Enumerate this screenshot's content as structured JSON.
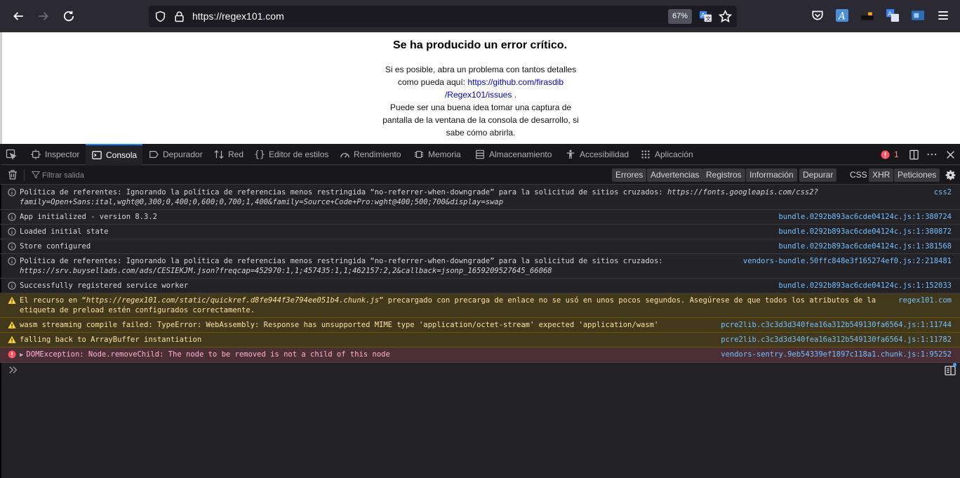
{
  "browser": {
    "url": "https://regex101.com",
    "zoom": "67%",
    "icons": [
      "back-arrow-icon",
      "forward-arrow-icon",
      "reload-icon",
      "shield-icon",
      "lock-icon",
      "translate-icon",
      "bookmark-star-icon",
      "pocket-icon",
      "extension-a-icon",
      "extension-dark-icon",
      "translate-ext-icon",
      "extension-blue-icon",
      "hamburger-menu-icon"
    ]
  },
  "page": {
    "title": "Se ha producido un error crítico.",
    "line1": "Si es posible, abra un problema con tantos detalles como pueda aquí:",
    "link": "https://github.com/firasdib/Regex101/issues",
    "link_line1": "https://github.com/firasdib",
    "link_line2": "/Regex101/issues",
    "after_link": " .",
    "line2": "Puede ser una buena idea tomar una captura de pantalla de la ventana de la consola de desarrollo, si sabe cómo abrirla."
  },
  "devtools": {
    "tabs": [
      {
        "label": "Inspector"
      },
      {
        "label": "Consola"
      },
      {
        "label": "Depurador"
      },
      {
        "label": "Red"
      },
      {
        "label": "Editor de estilos"
      },
      {
        "label": "Rendimiento"
      },
      {
        "label": "Memoria"
      },
      {
        "label": "Almacenamiento"
      },
      {
        "label": "Accesibilidad"
      },
      {
        "label": "Aplicación"
      }
    ],
    "active_tab": "Consola",
    "error_count": "1",
    "filter_placeholder": "Filtrar salida",
    "filter_buttons": [
      "Errores",
      "Advertencias",
      "Registros",
      "Información",
      "Depurar"
    ],
    "request_buttons": [
      "CSS",
      "XHR",
      "Peticiones"
    ]
  },
  "console": {
    "rows": [
      {
        "level": "info",
        "text": "Política de referentes: Ignorando la política de referencias menos restringida “no-referrer-when-downgrade” para la solicitud de sitios cruzados: ",
        "italic": "https://fonts.googleapis.com/css2?family=Open+Sans:ital,wght@0,300;0,400;0,600;0,700;1,400&family=Source+Code+Pro:wght@400;500;700&display=swap",
        "source": "css2"
      },
      {
        "level": "info",
        "text": "App initialized - version 8.3.2",
        "italic": "",
        "source": "bundle.0292b893ac6cde04124c.js:1:380724"
      },
      {
        "level": "info",
        "text": "Loaded initial state",
        "italic": "",
        "source": "bundle.0292b893ac6cde04124c.js:1:380872"
      },
      {
        "level": "info",
        "text": "Store configured",
        "italic": "",
        "source": "bundle.0292b893ac6cde04124c.js:1:381568"
      },
      {
        "level": "info",
        "text": "Política de referentes: Ignorando la política de referencias menos restringida “no-referrer-when-downgrade” para la solicitud de sitios cruzados: ",
        "italic": "https://srv.buysellads.com/ads/CESIEKJM.json?freqcap=452970:1,1;457435:1,1;462157:2,2&callback=jsonp_1659209527645_66068",
        "source": "vendors-bundle.50ffc848e3f165274ef0.js:2:218481"
      },
      {
        "level": "info",
        "text": "Successfully registered service worker",
        "italic": "",
        "source": "bundle.0292b893ac6cde04124c.js:1:152033"
      },
      {
        "level": "warn",
        "text": "El recurso en “",
        "italic": "https://regex101.com/static/quickref.d8fe944f3e794ee051b4.chunk.js",
        "text_after": "” precargado con precarga de enlace no se usó en unos pocos segundos. Asegúrese de que todos los atributos de la etiqueta de preload estén configurados correctamente.",
        "source": "regex101.com"
      },
      {
        "level": "warn",
        "text": "wasm streaming compile failed: TypeError: WebAssembly: Response has unsupported MIME type 'application/octet-stream' expected 'application/wasm'",
        "italic": "",
        "source": "pcre2lib.c3c3d3d340fea16a312b549130fa6564.js:1:11744"
      },
      {
        "level": "warn",
        "text": "falling back to ArrayBuffer instantiation",
        "italic": "",
        "source": "pcre2lib.c3c3d3d340fea16a312b549130fa6564.js:1:11782"
      },
      {
        "level": "error",
        "text": "DOMException: Node.removeChild: The node to be removed is not a child of this node",
        "italic": "",
        "source": "vendors-sentry.9eb54339ef1897c118a1.chunk.js:1:95252"
      }
    ]
  }
}
